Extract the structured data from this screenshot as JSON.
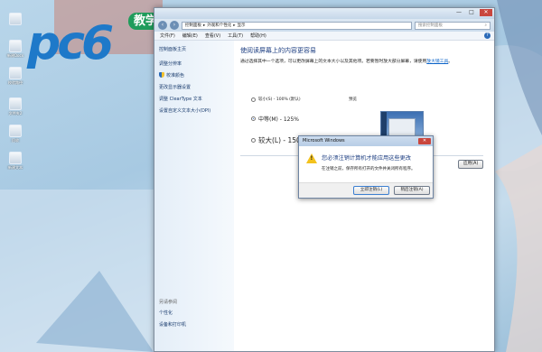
{
  "logo": {
    "text": "pc6",
    "tag": "教学"
  },
  "desktop": {
    "icons": [
      "",
      "新建Docx",
      "校验路径",
      "文件夹2",
      "回收",
      "新建文本"
    ]
  },
  "window": {
    "controls": [
      "—",
      "□",
      "✕"
    ],
    "breadcrumb": [
      "控制面板",
      "外观和个性化",
      "显示"
    ],
    "search_placeholder": "搜索控制面板",
    "menu": [
      "文件(F)",
      "编辑(E)",
      "查看(V)",
      "工具(T)",
      "帮助(H)"
    ]
  },
  "sidebar": {
    "home": "控制面板主页",
    "links": [
      "调整分辨率",
      "校准颜色",
      "更改显示器设置",
      "调整 ClearType 文本",
      "设置自定义文本大小(DPI)"
    ],
    "see_also_title": "另请参阅",
    "see_also": [
      "个性化",
      "设备和打印机"
    ]
  },
  "main": {
    "title": "使阅读屏幕上的内容更容易",
    "description": "通过选择其中一个选项，可以更改屏幕上的文本大小以及其他项。若要暂时放大部分屏幕，请使用",
    "description_link": "放大镜工具",
    "description_end": "。",
    "options": [
      {
        "label": "较小(S) - 100% (默认)",
        "selected": false
      },
      {
        "label": "中等(M) - 125%",
        "selected": true
      },
      {
        "label": "较大(L) - 150%",
        "selected": false
      }
    ],
    "preview_label": "预览",
    "apply_button": "应用(A)"
  },
  "dialog": {
    "title": "Microsoft Windows",
    "message": "您必须注销计算机才能应用这些更改",
    "sub": "在注销之前，保存所有打开的文件并关闭所有程序。",
    "logoff_now": "立即注销(L)",
    "logoff_later": "稍后注销(A)"
  }
}
